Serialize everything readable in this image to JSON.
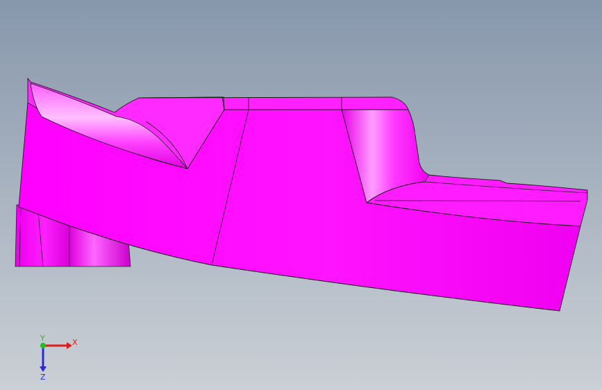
{
  "viewport": {
    "background_top": "#8797ac",
    "background_bottom": "#cbd0d6"
  },
  "model": {
    "face_color": "#ff00ff",
    "shadow_color": "#d400d4",
    "highlight_color": "#ff9dff",
    "edge_color": "#1a1a1a"
  },
  "triad": {
    "x_label": "X",
    "y_label": "Y",
    "z_label": "Z",
    "x_color": "#e01b1b",
    "y_color": "#1fbf1f",
    "z_color": "#2a2ad0"
  }
}
